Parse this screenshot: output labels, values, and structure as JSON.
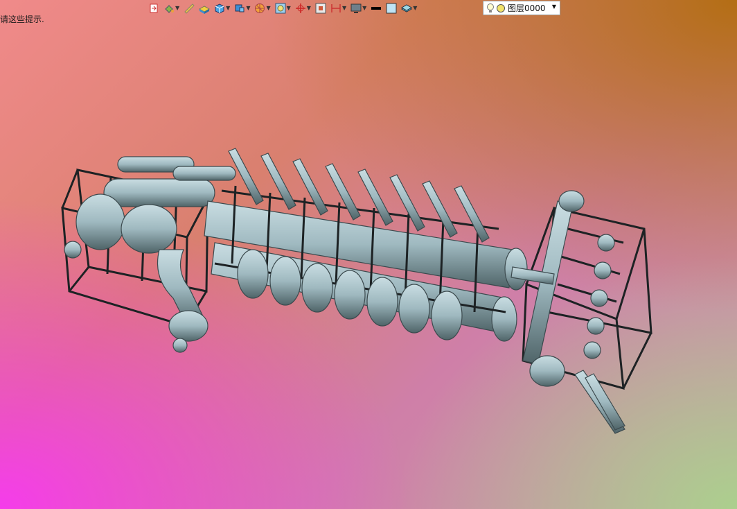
{
  "hint_text": "请这些提示.",
  "toolbar": {
    "items": [
      {
        "icon": "exit-sketch-icon",
        "dropdown": false
      },
      {
        "icon": "paint-bucket-icon",
        "dropdown": true
      },
      {
        "icon": "measure-icon",
        "dropdown": false
      },
      {
        "icon": "material-icon",
        "dropdown": false
      },
      {
        "icon": "render-cube-icon",
        "dropdown": true
      },
      {
        "icon": "view-cube-icon",
        "dropdown": true
      },
      {
        "icon": "section-view-icon",
        "dropdown": true
      },
      {
        "icon": "zoom-view-icon",
        "dropdown": true
      },
      {
        "icon": "origin-axis-icon",
        "dropdown": true
      },
      {
        "icon": "fit-view-icon",
        "dropdown": false
      },
      {
        "icon": "dimension-icon",
        "dropdown": true
      },
      {
        "icon": "display-mode-icon",
        "dropdown": true
      },
      {
        "icon": "line-color-icon",
        "dropdown": false
      },
      {
        "icon": "face-color-icon",
        "dropdown": false
      },
      {
        "icon": "layer-tool-icon",
        "dropdown": true
      }
    ],
    "layer": {
      "label": "图层0000",
      "bulb_color": "#f2e36a"
    }
  },
  "colors": {
    "model": "#9fb9c0",
    "model_dark": "#3c4a4e",
    "frame": "#1d2224"
  }
}
